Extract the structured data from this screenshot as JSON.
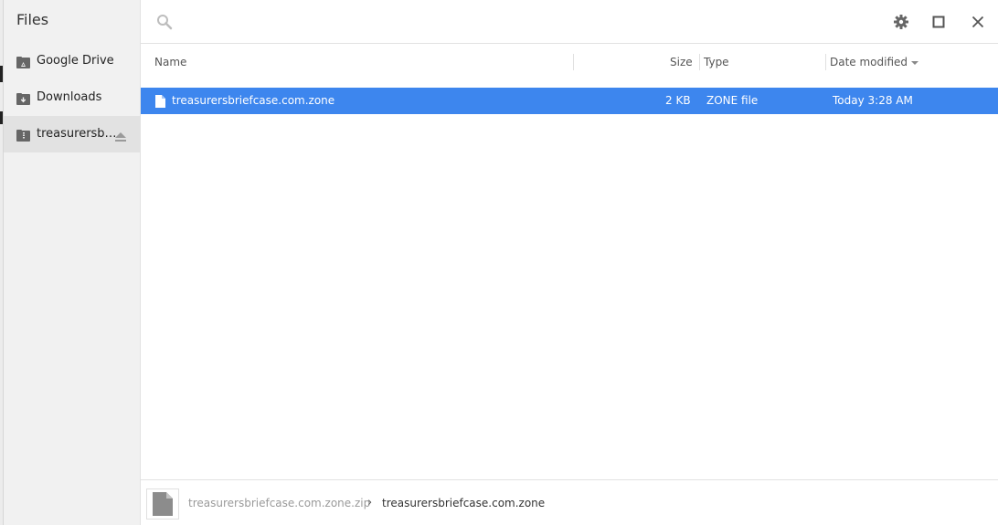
{
  "app": {
    "title": "Files"
  },
  "sidebar": {
    "items": [
      {
        "label": "Google Drive",
        "icon": "google-drive-icon"
      },
      {
        "label": "Downloads",
        "icon": "downloads-folder-icon"
      },
      {
        "label": "treasurersb…",
        "icon": "archive-icon",
        "active": true,
        "eject_icon": "eject-icon"
      }
    ]
  },
  "toolbar": {
    "search": {
      "value": "",
      "placeholder": "",
      "icon": "search-icon"
    },
    "buttons": [
      {
        "name": "settings",
        "icon": "gear-icon"
      },
      {
        "name": "maximize",
        "icon": "maximize-icon"
      },
      {
        "name": "close",
        "icon": "close-icon"
      }
    ]
  },
  "columns": {
    "name": "Name",
    "size": "Size",
    "type": "Type",
    "date": "Date modified",
    "sort": {
      "column": "date",
      "direction": "descending"
    }
  },
  "files": [
    {
      "name": "treasurersbriefcase.com.zone",
      "size": "2 KB",
      "type": "ZONE file",
      "date": "Today 3:28 AM",
      "selected": true,
      "icon": "generic-file-icon"
    }
  ],
  "breadcrumb": {
    "parent": "treasurersbriefcase.com.zone.zip",
    "separator": "›",
    "current": "treasurersbriefcase.com.zone",
    "thumbnail_icon": "file-thumbnail-icon"
  },
  "colors": {
    "selection": "#3d86ee",
    "sidebar_bg": "#f1f1f1",
    "sidebar_active": "#e2e2e2"
  }
}
